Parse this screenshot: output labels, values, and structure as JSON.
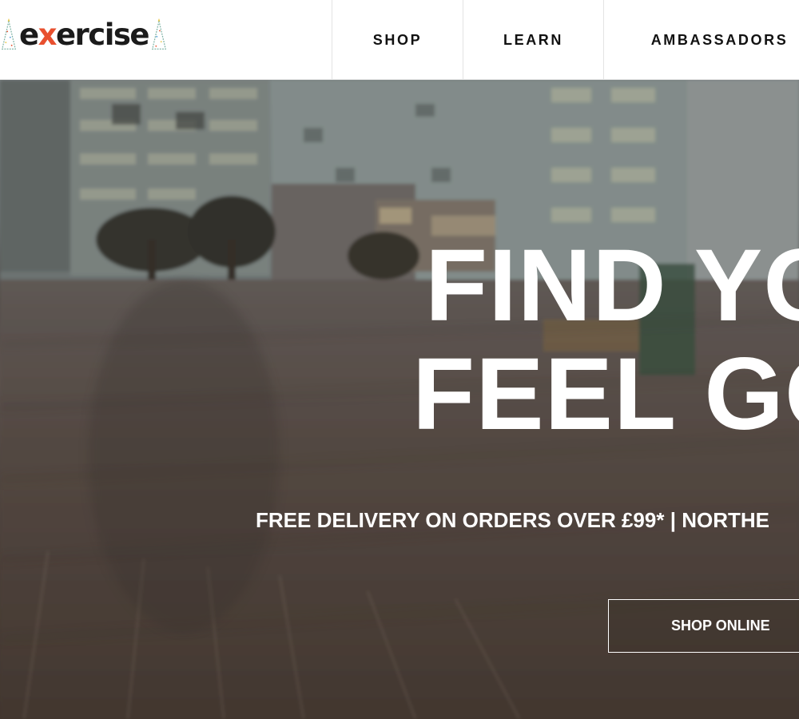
{
  "header": {
    "logo": {
      "text_prefix": "e",
      "text_x": "x",
      "text_suffix": "ercise",
      "accent_color": "#e8502f"
    },
    "nav": [
      {
        "label": "SHOP"
      },
      {
        "label": "LEARN"
      },
      {
        "label": "AMBASSADORS"
      }
    ]
  },
  "hero": {
    "headline_line1": "FIND YO",
    "headline_line2": "FEEL GO",
    "tagline": "FREE DELIVERY ON ORDERS OVER £99* | NORTHE",
    "cta_label": "SHOP ONLINE"
  }
}
